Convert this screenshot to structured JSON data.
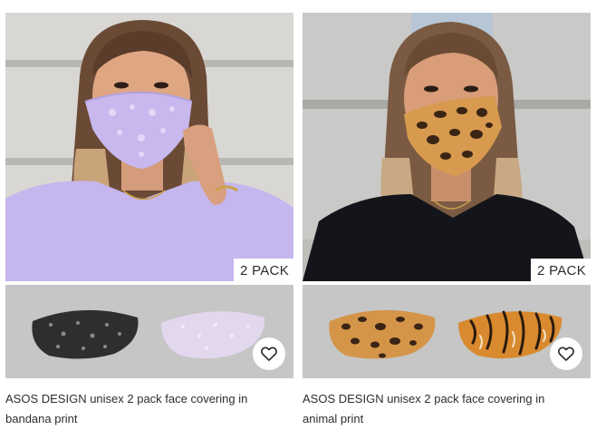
{
  "products": [
    {
      "title": "ASOS DESIGN unisex 2 pack face covering in bandana print",
      "badge": "2 PACK",
      "wishlist_icon": "heart-icon"
    },
    {
      "title": "ASOS DESIGN unisex 2 pack face covering in animal print",
      "badge": "2 PACK",
      "wishlist_icon": "heart-icon"
    }
  ]
}
